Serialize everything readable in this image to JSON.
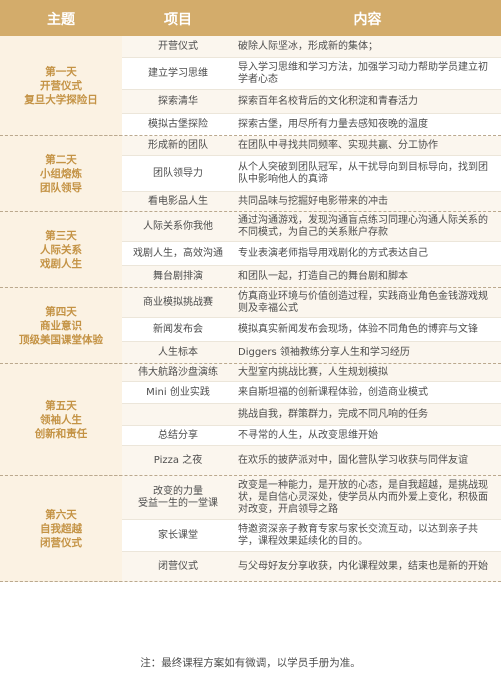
{
  "header": {
    "col1": "主题",
    "col2": "项目",
    "col3": "内容"
  },
  "days": [
    {
      "title_lines": [
        "第一天",
        "开营仪式",
        "复旦大学探险日"
      ],
      "rows": [
        {
          "item": "开营仪式",
          "content": "破除人际坚冰，形成新的集体；"
        },
        {
          "item": "建立学习思维",
          "content": "导入学习思维和学习方法，加强学习动力帮助学员建立初学者心态"
        },
        {
          "item": "探索清华",
          "content": "探索百年名校背后的文化积淀和青春活力"
        },
        {
          "item": "模拟古堡探险",
          "content": "探索古堡，用尽所有力量去感知夜晚的温度"
        }
      ]
    },
    {
      "title_lines": [
        "第二天",
        "小组熔炼",
        "团队领导"
      ],
      "rows": [
        {
          "item": "形成新的团队",
          "content": "在团队中寻找共同频率、实现共赢、分工协作"
        },
        {
          "item": "团队领导力",
          "content": "从个人突破到团队冠军，从干扰导向到目标导向，找到团队中影响他人的真谛"
        },
        {
          "item": "看电影品人生",
          "content": "共同品味与挖掘好电影带来的冲击"
        }
      ]
    },
    {
      "title_lines": [
        "第三天",
        "人际关系",
        "戏剧人生"
      ],
      "rows": [
        {
          "item": "人际关系你我他",
          "content": "通过沟通游戏，发现沟通盲点练习同理心沟通人际关系的不同模式，为自己的关系账户存款"
        },
        {
          "item": "戏剧人生，高效沟通",
          "content": "专业表演老师指导用戏剧化的方式表达自己"
        },
        {
          "item": "舞台剧排演",
          "content": "和团队一起，打造自己的舞台剧和脚本"
        }
      ]
    },
    {
      "title_lines": [
        "第四天",
        "商业意识",
        "顶级美国课堂体验"
      ],
      "rows": [
        {
          "item": "商业模拟挑战赛",
          "content": "仿真商业环境与价值创造过程，实践商业角色金钱游戏规则及幸福公式"
        },
        {
          "item": "新闻发布会",
          "content": "模拟真实新闻发布会现场，体验不同角色的博弈与文锋"
        },
        {
          "item": "人生标本",
          "content": "Diggers 领袖教练分享人生和学习经历"
        }
      ]
    },
    {
      "title_lines": [
        "第五天",
        "领袖人生",
        "创新和责任"
      ],
      "rows": [
        {
          "item": "伟大航路沙盘演练",
          "content": "大型室内挑战比赛，人生规划模拟"
        },
        {
          "item": "Mini 创业实践",
          "content": "来自斯坦福的创新课程体验，创造商业模式"
        },
        {
          "item": "",
          "content": "挑战自我，群策群力，完成不同凡响的任务"
        },
        {
          "item": "总结分享",
          "content": "不寻常的人生，从改变思维开始"
        },
        {
          "item": "Pizza 之夜",
          "content": "在欢乐的披萨派对中，固化营队学习收获与同伴友谊"
        }
      ]
    },
    {
      "title_lines": [
        "第六天",
        "自我超越",
        "闭营仪式"
      ],
      "rows": [
        {
          "item": "改变的力量\n受益一生的一堂课",
          "content": "改变是一种能力，是开放的心态，是自我超越，是挑战现状，是自信心灵深处，使学员从内而外爱上变化，积极面对改变，开启领导之路"
        },
        {
          "item": "家长课堂",
          "content": "特邀资深亲子教育专家与家长交流互动，以达到亲子共学，课程效果延续化的目的。"
        },
        {
          "item": "闭营仪式",
          "content": "与父母好友分享收获，内化课程效果，结束也是新的开始"
        }
      ]
    }
  ],
  "footnote": "注：最终课程方案如有微调，以学员手册为准。"
}
